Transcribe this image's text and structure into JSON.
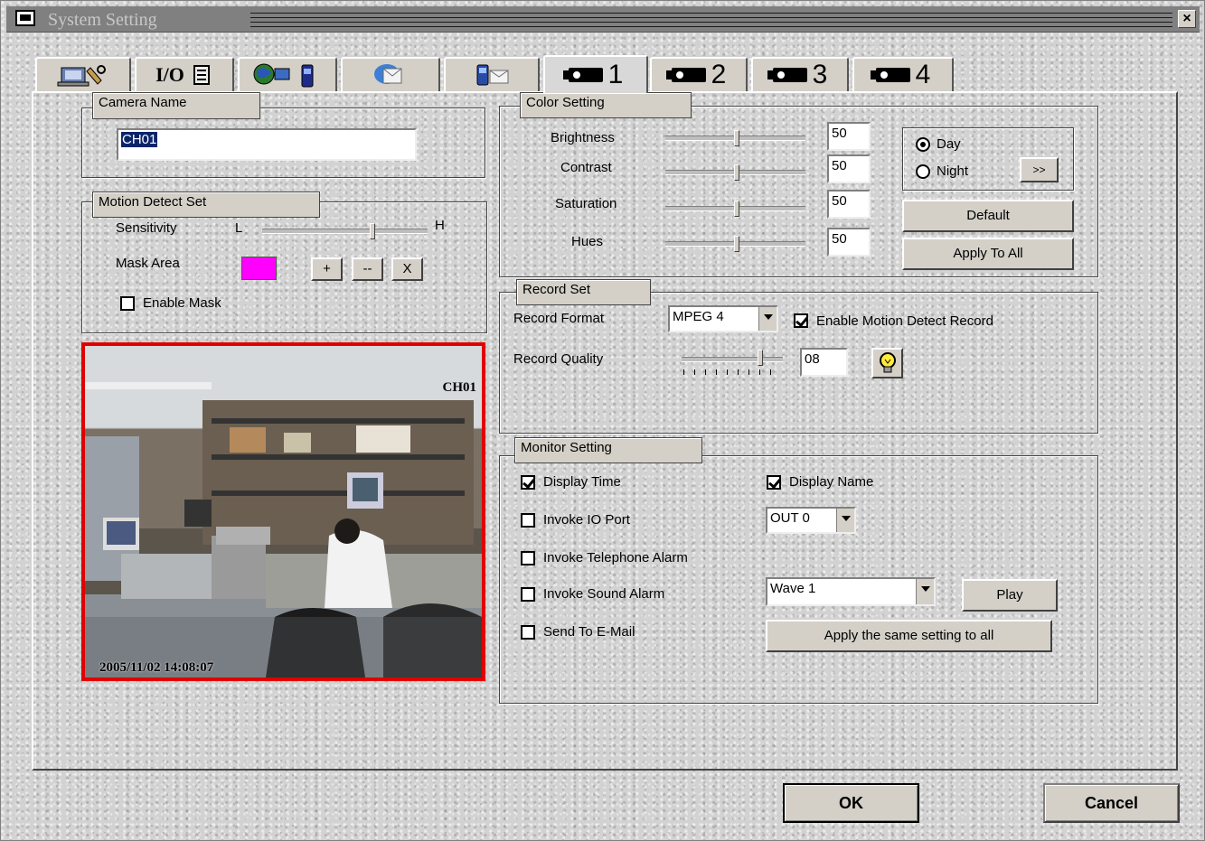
{
  "window": {
    "title": "System Setting",
    "close_label": "×"
  },
  "tabs": [
    {
      "icon": "computer-tools-icon"
    },
    {
      "icon": "io-icon",
      "label": "I/O"
    },
    {
      "icon": "network-phone-icon"
    },
    {
      "icon": "email-icon"
    },
    {
      "icon": "mobile-message-icon"
    },
    {
      "icon": "camera-icon",
      "label": "1"
    },
    {
      "icon": "camera-icon",
      "label": "2"
    },
    {
      "icon": "camera-icon",
      "label": "3"
    },
    {
      "icon": "camera-icon",
      "label": "4"
    }
  ],
  "active_tab": "1",
  "camera_name": {
    "legend": "Camera Name",
    "value": "CH01"
  },
  "motion_detect": {
    "legend": "Motion Detect Set",
    "sensitivity_label": "Sensitivity",
    "low_label": "L",
    "high_label": "H",
    "sensitivity_level": 0.67,
    "mask_area_label": "Mask Area",
    "mask_color": "#ff00ff",
    "add_label": "+",
    "remove_label": "--",
    "clear_label": "X",
    "enable_mask_label": "Enable Mask",
    "enable_mask_checked": false
  },
  "video": {
    "channel_label": "CH01",
    "timestamp": "2005/11/02 14:08:07",
    "border_color": "#e00000"
  },
  "color_setting": {
    "legend": "Color Setting",
    "rows": [
      {
        "label": "Brightness",
        "value": "50"
      },
      {
        "label": "Contrast",
        "value": "50"
      },
      {
        "label": "Saturation",
        "value": "50"
      },
      {
        "label": "Hues",
        "value": "50"
      }
    ],
    "day_label": "Day",
    "night_label": "Night",
    "selected_mode": "Day",
    "more_label": ">>",
    "default_label": "Default",
    "apply_all_label": "Apply To All"
  },
  "record_set": {
    "legend": "Record Set",
    "format_label": "Record Format",
    "format_value": "MPEG 4",
    "motion_record_label": "Enable Motion Detect Record",
    "motion_record_checked": true,
    "quality_label": "Record Quality",
    "quality_value": "08",
    "tip_icon": "lightbulb-icon"
  },
  "monitor_setting": {
    "legend": "Monitor Setting",
    "display_time_label": "Display Time",
    "display_time_checked": true,
    "display_name_label": "Display Name",
    "display_name_checked": true,
    "io_port_label": "Invoke IO Port",
    "io_port_checked": false,
    "io_port_value": "OUT 0",
    "telephone_label": "Invoke Telephone Alarm",
    "telephone_checked": false,
    "sound_label": "Invoke Sound Alarm",
    "sound_checked": false,
    "sound_value": "Wave 1",
    "play_label": "Play",
    "email_label": "Send To E-Mail",
    "email_checked": false,
    "apply_same_label": "Apply the same setting to all"
  },
  "footer": {
    "ok_label": "OK",
    "cancel_label": "Cancel"
  }
}
